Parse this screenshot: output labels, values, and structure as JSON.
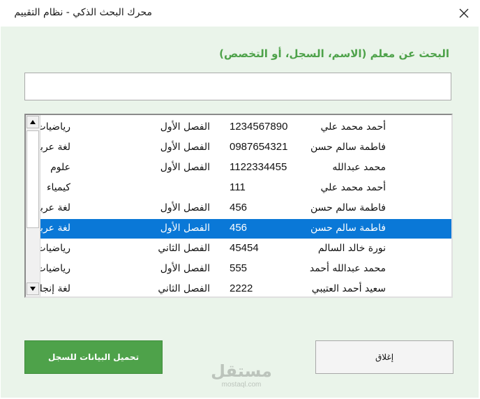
{
  "window": {
    "title": "محرك البحث الذكي - نظام التقييم"
  },
  "form": {
    "heading": "البحث عن معلم (الاسم، السجل، أو التخصص)",
    "search": {
      "value": "",
      "placeholder": ""
    },
    "rows": [
      {
        "name": "أحمد محمد علي",
        "id": "1234567890",
        "semester": "الفصل الأول",
        "subject": "رياضيات",
        "selected": false
      },
      {
        "name": "فاطمة سالم حسن",
        "id": "0987654321",
        "semester": "الفصل الأول",
        "subject": "لغة عربية",
        "selected": false
      },
      {
        "name": "محمد عبدالله",
        "id": "1122334455",
        "semester": "الفصل الأول",
        "subject": "علوم",
        "selected": false
      },
      {
        "name": "أحمد محمد علي",
        "id": "111",
        "semester": "",
        "subject": "كيمياء",
        "selected": false
      },
      {
        "name": "فاطمة سالم حسن",
        "id": "456",
        "semester": "الفصل الأول",
        "subject": "لغة عربية",
        "selected": false
      },
      {
        "name": "فاطمة سالم حسن",
        "id": "456",
        "semester": "الفصل الأول",
        "subject": "لغة عربية",
        "selected": true
      },
      {
        "name": "نورة خالد السالم",
        "id": "45454",
        "semester": "الفصل الثاني",
        "subject": "رياضيات",
        "selected": false
      },
      {
        "name": "محمد عبدالله أحمد",
        "id": "555",
        "semester": "الفصل الأول",
        "subject": "رياضيات",
        "selected": false
      },
      {
        "name": "سعيد أحمد العتيبي",
        "id": "2222",
        "semester": "الفصل الثاني",
        "subject": "لغة إنجليزية",
        "selected": false
      }
    ],
    "scrollbar": {
      "up_icon": "triangle-up-icon",
      "down_icon": "triangle-down-icon"
    },
    "load_button": "تحميل البيانات للسجل",
    "close_button": "إغلاق"
  },
  "watermark": {
    "arabic": "مستقل",
    "latin": "mostaql.com"
  },
  "colors": {
    "accent": "#4ea24a",
    "background": "#eaf4ea",
    "selection": "#0a78d7"
  }
}
